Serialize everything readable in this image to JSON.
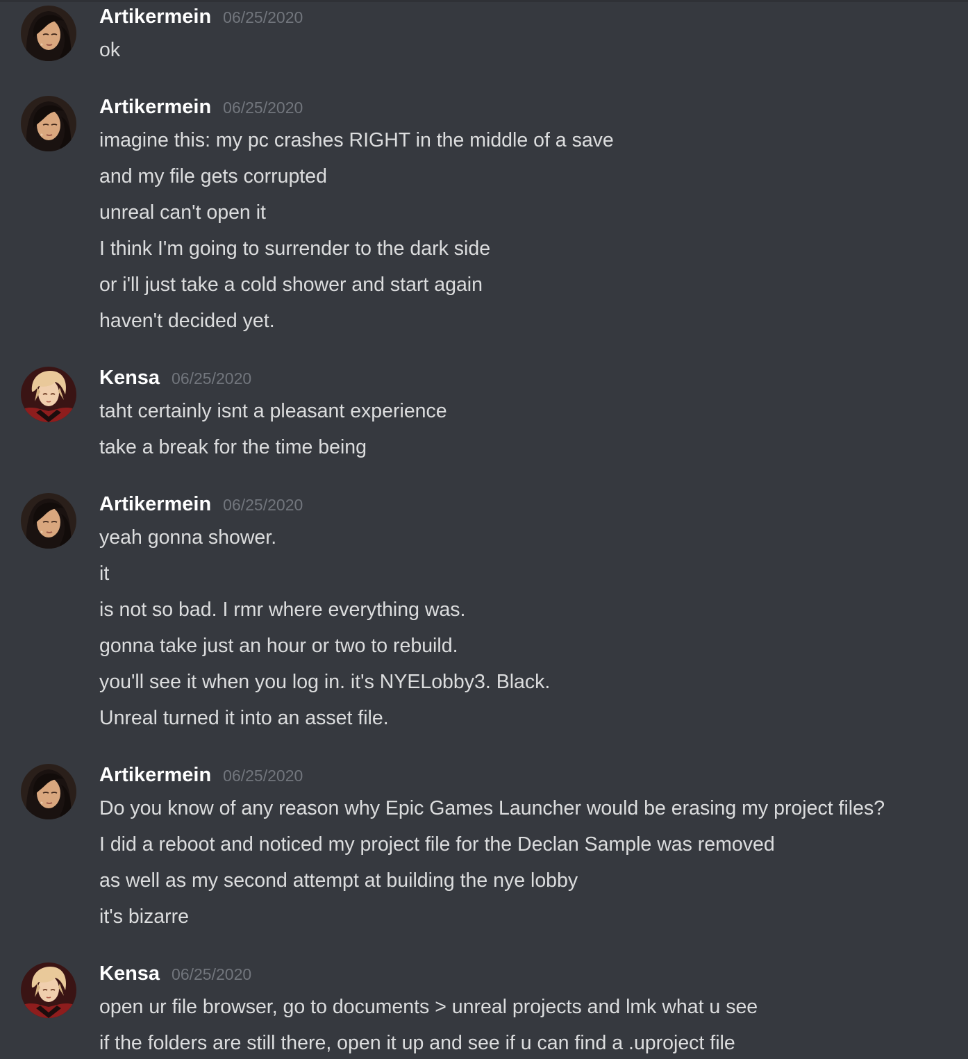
{
  "messages": [
    {
      "author": "Artikermein",
      "avatar_icon": "user-avatar-artikermein",
      "timestamp": "06/25/2020",
      "lines": [
        "ok"
      ]
    },
    {
      "author": "Artikermein",
      "avatar_icon": "user-avatar-artikermein",
      "timestamp": "06/25/2020",
      "lines": [
        "imagine this: my pc crashes RIGHT in the middle of a save",
        "and my file gets corrupted",
        "unreal can't open it",
        "I think I'm going to surrender to the dark side",
        "or i'll just take a cold shower and start again",
        "haven't decided yet."
      ]
    },
    {
      "author": "Kensa",
      "avatar_icon": "user-avatar-kensa",
      "timestamp": "06/25/2020",
      "lines": [
        "taht certainly isnt a pleasant experience",
        "take a break for the time being"
      ]
    },
    {
      "author": "Artikermein",
      "avatar_icon": "user-avatar-artikermein",
      "timestamp": "06/25/2020",
      "lines": [
        "yeah gonna shower.",
        "it",
        "is not so bad. I rmr where everything was.",
        "gonna take just an hour or two to rebuild.",
        "you'll see it when you log in. it's NYELobby3. Black.",
        "Unreal turned it into an asset file."
      ]
    },
    {
      "author": "Artikermein",
      "avatar_icon": "user-avatar-artikermein",
      "timestamp": "06/25/2020",
      "lines": [
        "Do you know of any reason why Epic Games Launcher would be erasing my project files?",
        "I did a reboot and noticed my project file for the Declan Sample was removed",
        "as well as my second attempt at building the nye lobby",
        "it's bizarre"
      ]
    },
    {
      "author": "Kensa",
      "avatar_icon": "user-avatar-kensa",
      "timestamp": "06/25/2020",
      "lines": [
        "open ur file browser, go to documents > unreal projects and lmk what u see",
        "if the folders are still there, open it up and see if u can find a .uproject file"
      ]
    }
  ],
  "colors": {
    "background": "#36393f",
    "username": "#ffffff",
    "timestamp": "#72767d",
    "message_text": "#dcddde"
  }
}
